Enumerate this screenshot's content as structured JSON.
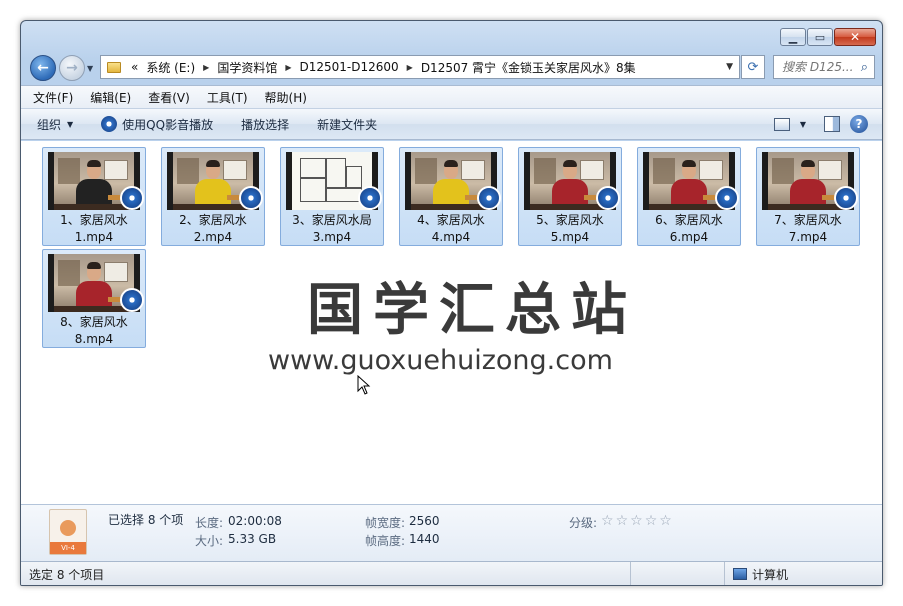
{
  "address": {
    "prefix": "«",
    "crumbs": [
      "系统 (E:)",
      "国学资料馆",
      "D12501-D12600",
      "D12507 霄宁《金锁玉关家居风水》8集"
    ]
  },
  "search": {
    "placeholder": "搜索 D125..."
  },
  "menu": [
    "文件(F)",
    "编辑(E)",
    "查看(V)",
    "工具(T)",
    "帮助(H)"
  ],
  "toolbar": {
    "organize": "组织",
    "qq_play": "使用QQ影音播放",
    "play_selection": "播放选择",
    "new_folder": "新建文件夹"
  },
  "files": [
    {
      "line1": "1、家居风水",
      "line2": "1.mp4",
      "shirt": "#222222",
      "thumb": "person"
    },
    {
      "line1": "2、家居风水",
      "line2": "2.mp4",
      "shirt": "#e3c21c",
      "thumb": "person"
    },
    {
      "line1": "3、家居风水局",
      "line2": "3.mp4",
      "shirt": "",
      "thumb": "plan"
    },
    {
      "line1": "4、家居风水",
      "line2": "4.mp4",
      "shirt": "#e3c21c",
      "thumb": "person"
    },
    {
      "line1": "5、家居风水",
      "line2": "5.mp4",
      "shirt": "#a7242b",
      "thumb": "person"
    },
    {
      "line1": "6、家居风水",
      "line2": "6.mp4",
      "shirt": "#a7242b",
      "thumb": "person"
    },
    {
      "line1": "7、家居风水",
      "line2": "7.mp4",
      "shirt": "#a7242b",
      "thumb": "person"
    },
    {
      "line1": "8、家居风水",
      "line2": "8.mp4",
      "shirt": "#a7242b",
      "thumb": "person"
    }
  ],
  "watermark": {
    "title": "国学汇总站",
    "url": "www.guoxuehuizong.com"
  },
  "details": {
    "selected": "已选择 8 个项",
    "duration_label": "长度:",
    "duration": "02:00:08",
    "size_label": "大小:",
    "size": "5.33 GB",
    "width_label": "帧宽度:",
    "width": "2560",
    "height_label": "帧高度:",
    "height": "1440",
    "rating_label": "分级:",
    "rating": 0,
    "file_tag": "VI-4"
  },
  "status": {
    "text": "选定 8 个项目",
    "location": "计算机"
  },
  "colors": {
    "selection": "#c6ddf5",
    "selection_border": "#84acdd",
    "close": "#c23a1d"
  }
}
